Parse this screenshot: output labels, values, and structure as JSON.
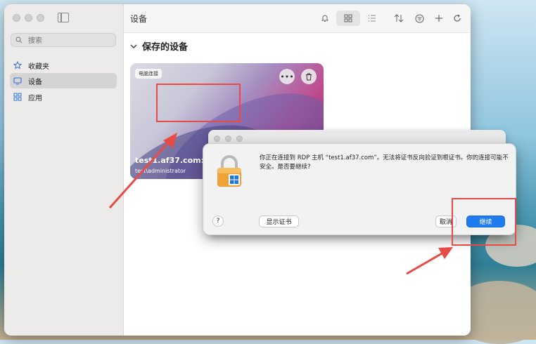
{
  "sidebar": {
    "search_placeholder": "搜索",
    "items": [
      {
        "label": "收藏夹",
        "icon": "star-icon"
      },
      {
        "label": "设备",
        "icon": "monitor-icon"
      },
      {
        "label": "应用",
        "icon": "apps-grid-icon"
      }
    ]
  },
  "toolbar": {
    "title": "设备",
    "icons": [
      "bell-icon",
      "grid-view-icon",
      "list-view-icon",
      "sort-icon",
      "filter-icon",
      "add-icon",
      "refresh-icon"
    ]
  },
  "main": {
    "section_title": "保存的设备",
    "card": {
      "badge": "电脑连接",
      "host": "test1.af37.com:95",
      "user": "test\\administrator",
      "more_icon": "more-icon",
      "delete_icon": "trash-icon"
    }
  },
  "dialog": {
    "message": "你正在连接到 RDP 主机 “test1.af37.com”。无法将证书反向验证到根证书。你的连接可能不安全。是否要继续?",
    "help_label": "?",
    "show_cert_label": "显示证书",
    "cancel_label": "取消",
    "continue_label": "继续",
    "icon": "lock-windows-icon"
  },
  "colors": {
    "accent": "#1f7cf0",
    "annotation": "#e84b45"
  }
}
